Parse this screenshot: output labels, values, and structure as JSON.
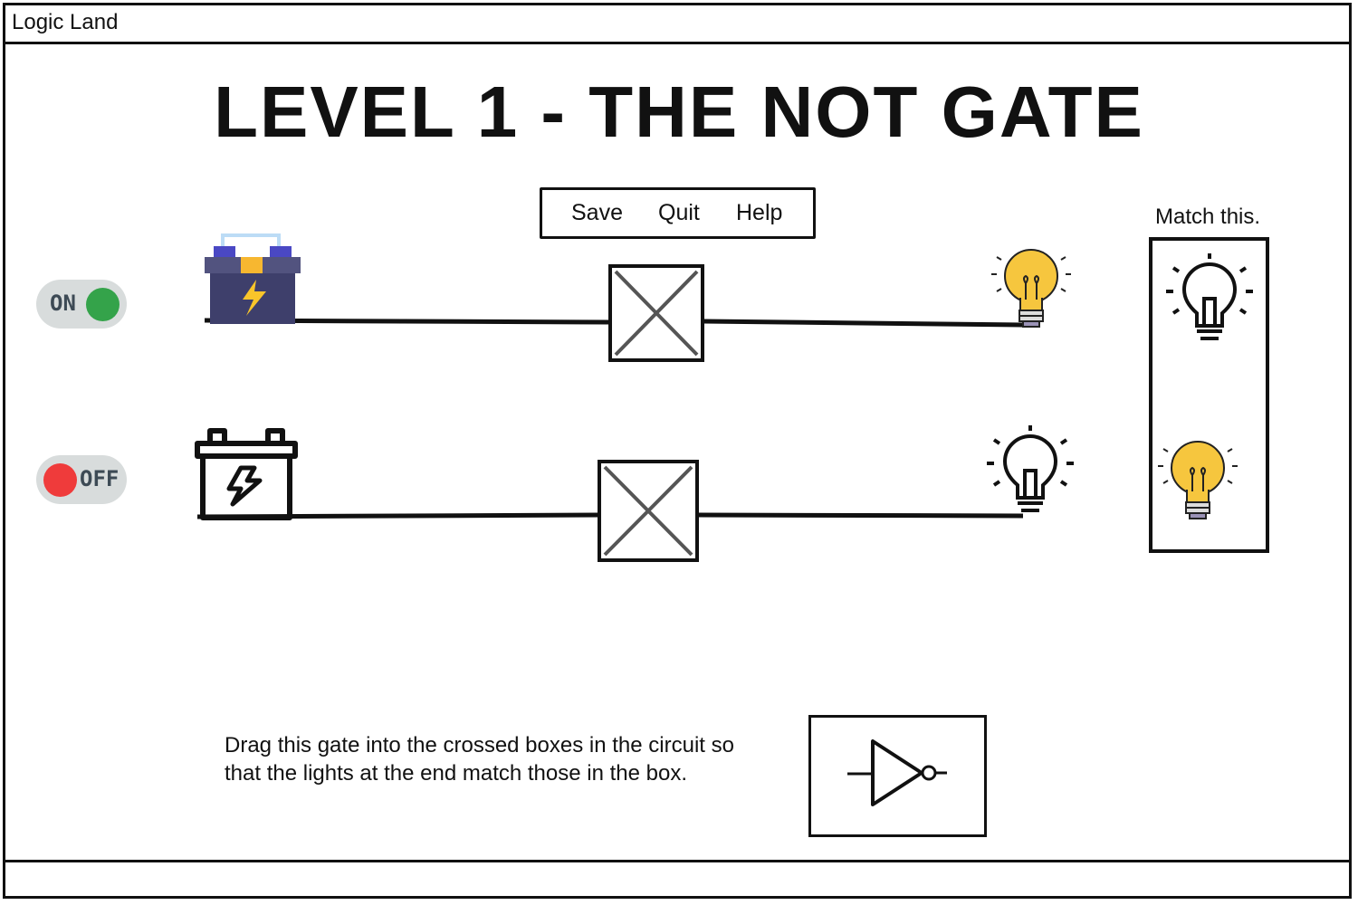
{
  "window": {
    "title": "Logic Land"
  },
  "level": {
    "title": "LEVEL 1 - THE NOT GATE"
  },
  "menu": {
    "items": [
      "Save",
      "Quit",
      "Help"
    ]
  },
  "target": {
    "label": "Match this.",
    "bulbs": [
      "off",
      "on"
    ]
  },
  "circuits": [
    {
      "switch_label": "ON",
      "switch_state": "on",
      "battery": "charged",
      "slot": "empty",
      "bulb": "on"
    },
    {
      "switch_label": "OFF",
      "switch_state": "off",
      "battery": "outline",
      "slot": "empty",
      "bulb": "off"
    }
  ],
  "instruction": "Drag this gate into the crossed boxes in the circuit so that the lights at the end match those in the box.",
  "palette": {
    "gate": "NOT"
  },
  "colors": {
    "on": "#34a34a",
    "off": "#ef3b3b",
    "bulb": "#f6c63e",
    "battery": "#3e3f6b",
    "bolt": "#f9c52a"
  }
}
